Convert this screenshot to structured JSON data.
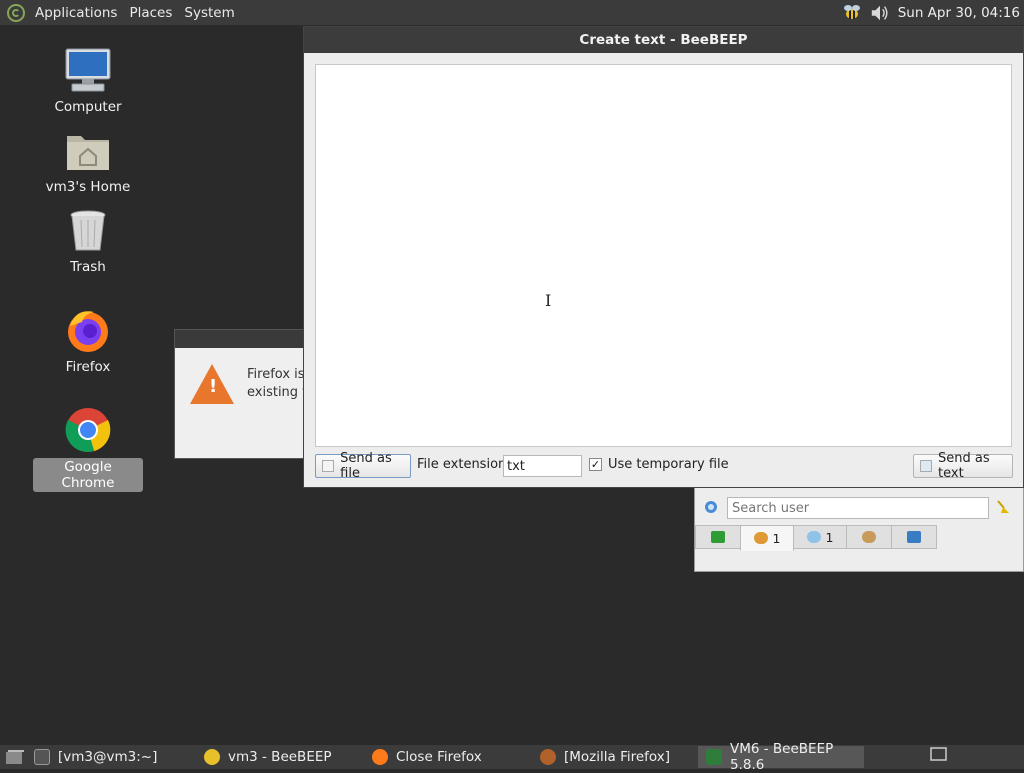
{
  "top_panel": {
    "menus": [
      "Applications",
      "Places",
      "System"
    ],
    "clock": "Sun Apr 30, 04:16",
    "tray_icons": [
      "beebeep-icon",
      "volume-icon"
    ]
  },
  "desktop": {
    "icons": [
      {
        "label": "Computer",
        "icon": "computer-icon"
      },
      {
        "label": "vm3's Home",
        "icon": "home-folder-icon"
      },
      {
        "label": "Trash",
        "icon": "trash-icon"
      },
      {
        "label": "Firefox",
        "icon": "firefox-icon"
      },
      {
        "label": "Google Chrome",
        "icon": "chrome-icon",
        "selected": true
      }
    ]
  },
  "firefox_dialog": {
    "line1": "Firefox is",
    "line2": "existing t"
  },
  "create_text_dialog": {
    "title": "Create text - BeeBEEP",
    "send_as_file_label": "Send as file",
    "file_extension_label": "File extension",
    "file_extension_value": "txt",
    "use_temp_file_label": "Use temporary file",
    "use_temp_file_checked": true,
    "send_as_text_label": "Send as text",
    "text_content": ""
  },
  "beebeep_main": {
    "search_placeholder": "Search user",
    "tabs": [
      {
        "icon": "monitor-icon",
        "label": ""
      },
      {
        "icon": "users-icon",
        "label": "1"
      },
      {
        "icon": "chat-icon",
        "label": "1"
      },
      {
        "icon": "groups-icon",
        "label": ""
      },
      {
        "icon": "share-icon",
        "label": ""
      }
    ]
  },
  "taskbar": {
    "items": [
      {
        "label": "[vm3@vm3:~]",
        "icon": "terminal-icon"
      },
      {
        "label": "vm3 - BeeBEEP",
        "icon": "beebeep-icon"
      },
      {
        "label": "Close Firefox",
        "icon": "firefox-icon"
      },
      {
        "label": "[Mozilla Firefox]",
        "icon": "firefox-icon"
      },
      {
        "label": "VM6 - BeeBEEP 5.8.6",
        "icon": "vm-icon",
        "active": true
      }
    ]
  },
  "colors": {
    "panel": "#3b3b3b",
    "desktop": "#2a2a2a",
    "dialog": "#ededed",
    "accent": "#87a556"
  }
}
